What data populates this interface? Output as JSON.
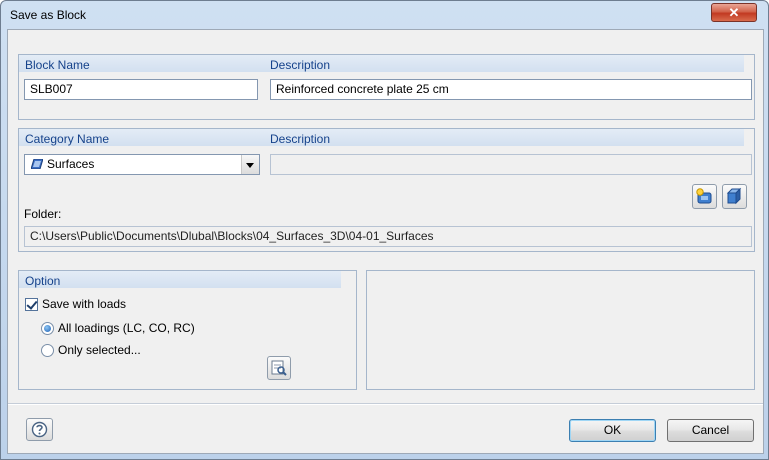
{
  "window": {
    "title": "Save as Block",
    "close_glyph": "✕"
  },
  "block": {
    "name_header": "Block Name",
    "desc_header": "Description",
    "name_value": "SLB007",
    "desc_value": "Reinforced concrete plate 25 cm"
  },
  "category": {
    "name_header": "Category Name",
    "desc_header": "Description",
    "selected": "Surfaces",
    "selected_icon": "surface-icon",
    "desc_value": "",
    "folder_label": "Folder:",
    "folder_path": "C:\\Users\\Public\\Documents\\Dlubal\\Blocks\\04_Surfaces_3D\\04-01_Surfaces",
    "new_category_icon": "new-category-icon",
    "edit_category_icon": "category-3d-icon"
  },
  "option": {
    "header": "Option",
    "save_with_loads": "Save with loads",
    "save_with_loads_checked": true,
    "all_loadings": "All loadings (LC, CO, RC)",
    "only_selected": "Only selected...",
    "selected_radio": "all_loadings",
    "select_icon": "select-loadings-icon"
  },
  "footer": {
    "help_icon": "help-icon",
    "ok_label": "OK",
    "cancel_label": "Cancel"
  }
}
